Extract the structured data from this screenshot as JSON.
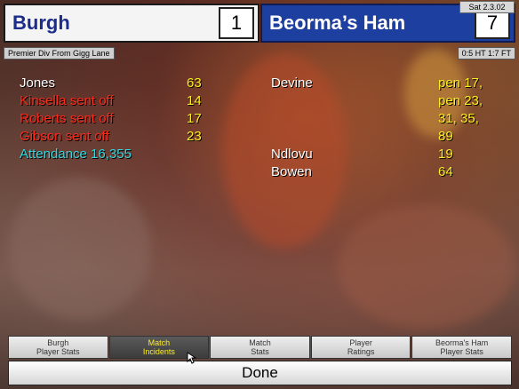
{
  "header": {
    "home": {
      "name": "Burgh",
      "score": "1"
    },
    "away": {
      "name": "Beorma’s Ham",
      "score": "7"
    },
    "date": "Sat 2.3.02",
    "competition": "Premier Div From Gigg Lane",
    "halftime_fulltime": "0:5 HT 1:7 FT"
  },
  "incidents": {
    "home_rows": [
      {
        "text": "Jones",
        "minutes": "63",
        "color": "#ffffff"
      },
      {
        "text": "Kinsella sent off",
        "minutes": "14",
        "color": "#ff2a1a"
      },
      {
        "text": "Roberts sent off",
        "minutes": "17",
        "color": "#ff2a1a"
      },
      {
        "text": "Gibson sent off",
        "minutes": "23",
        "color": "#ff2a1a"
      },
      {
        "text": "Attendance 16,355",
        "minutes": "",
        "color": "#30d8e0"
      }
    ],
    "away_rows": [
      {
        "text": "Devine",
        "minutes": "pen 17,"
      },
      {
        "text": "",
        "minutes": "pen 23,"
      },
      {
        "text": "",
        "minutes": "31, 35,"
      },
      {
        "text": "",
        "minutes": "89"
      },
      {
        "text": "Ndlovu",
        "minutes": "19"
      },
      {
        "text": "Bowen",
        "minutes": "64"
      }
    ]
  },
  "tabs": [
    {
      "line1": "Burgh",
      "line2": "Player Stats",
      "active": false
    },
    {
      "line1": "Match",
      "line2": "Incidents",
      "active": true
    },
    {
      "line1": "Match",
      "line2": "Stats",
      "active": false
    },
    {
      "line1": "Player",
      "line2": "Ratings",
      "active": false
    },
    {
      "line1": "Beorma's Ham",
      "line2": "Player Stats",
      "active": false
    }
  ],
  "done_label": "Done",
  "colors": {
    "home_bg": "#f4f4f4",
    "away_bg": "#1d3fa0",
    "goal_minutes": "#ffee22",
    "sent_off": "#ff2a1a",
    "attendance": "#30d8e0"
  },
  "icons": {
    "cursor": "arrow-cursor-icon"
  }
}
